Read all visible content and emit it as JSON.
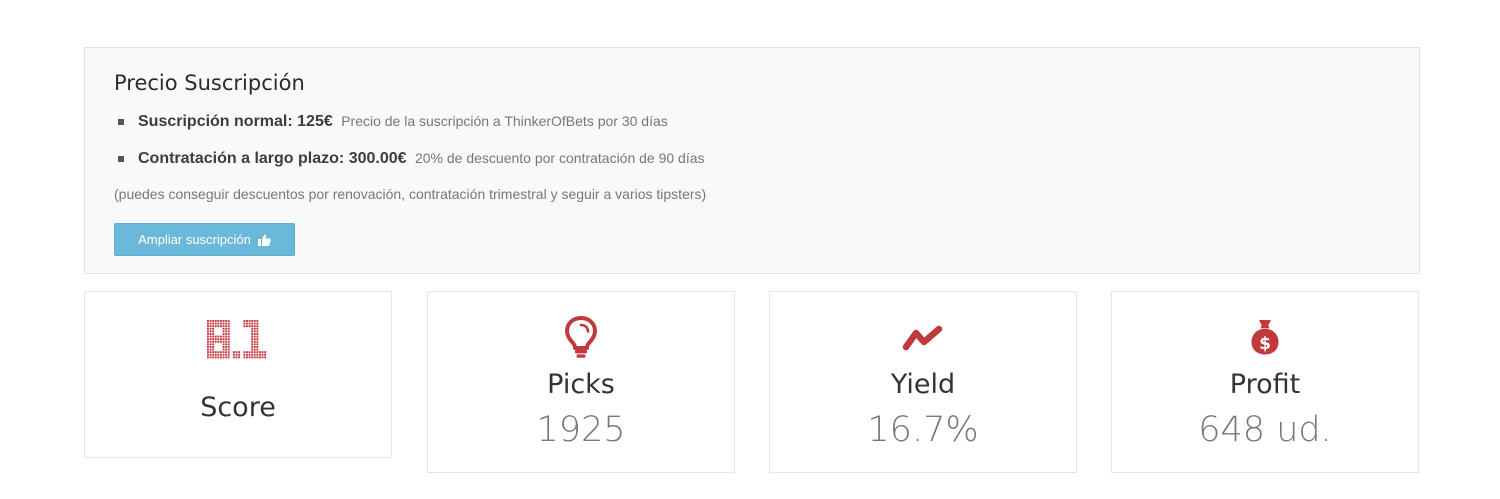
{
  "subscription": {
    "title": "Precio Suscripción",
    "items": [
      {
        "label": "Suscripción normal: 125€",
        "description": "Precio de la suscripción a ThinkerOfBets por 30 días"
      },
      {
        "label": "Contratación a largo plazo: 300.00€",
        "description": "20% de descuento por contratación de 90 días"
      }
    ],
    "note": "(puedes conseguir descuentos por renovación, contratación trimestral y seguir a varios tipsters)",
    "button_label": "Ampliar suscripción",
    "button_icon": "thumbs-up-icon"
  },
  "stats": [
    {
      "icon": "score-digits-icon",
      "label": "Score",
      "value": "",
      "score_digits": "8.1"
    },
    {
      "icon": "lightbulb-icon",
      "label": "Picks",
      "value": "1925"
    },
    {
      "icon": "trend-line-icon",
      "label": "Yield",
      "value": "16.7%"
    },
    {
      "icon": "money-bag-icon",
      "label": "Profit",
      "value": "648 ud."
    }
  ],
  "colors": {
    "accent_red": "#c1393d",
    "button_blue": "#6ab8da",
    "panel_bg": "#f8f9f9"
  }
}
